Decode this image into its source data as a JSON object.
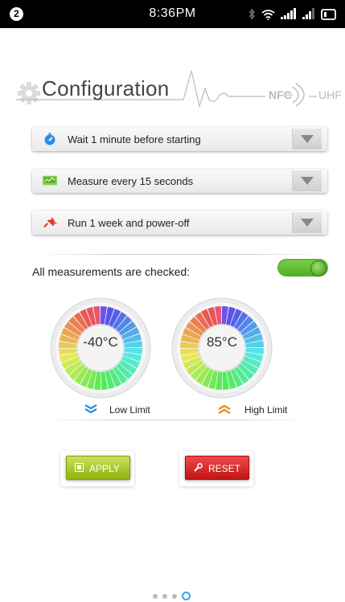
{
  "status_bar": {
    "notification_count": "2",
    "time": "8:36PM",
    "icons": [
      "bluetooth-icon",
      "wifi-icon",
      "signal-icon",
      "signal-icon",
      "battery-icon"
    ]
  },
  "header": {
    "title": "Configuration",
    "nfc_label": "NFC",
    "uhf_label": "UHF",
    "icon": "gear-icon"
  },
  "dropdowns": [
    {
      "icon": "stopwatch-icon",
      "label": "Wait 1 minute before starting"
    },
    {
      "icon": "screen-icon",
      "label": "Measure every 15 seconds"
    },
    {
      "icon": "power-plug-icon",
      "label": "Run 1 week and power-off"
    }
  ],
  "measurements": {
    "label": "All measurements are checked:",
    "toggle_on": true
  },
  "limits": {
    "low": {
      "value": "-40°C",
      "label": "Low Limit"
    },
    "high": {
      "value": "85°C",
      "label": "High Limit"
    }
  },
  "buttons": {
    "apply": "APPLY",
    "reset": "RESET"
  },
  "pager": {
    "pages": 4,
    "active": 4
  },
  "colors": {
    "accent_green": "#6cc53a",
    "apply_green": "#a8c830",
    "reset_red": "#d62b2b",
    "pager_blue": "#37a5e6"
  }
}
